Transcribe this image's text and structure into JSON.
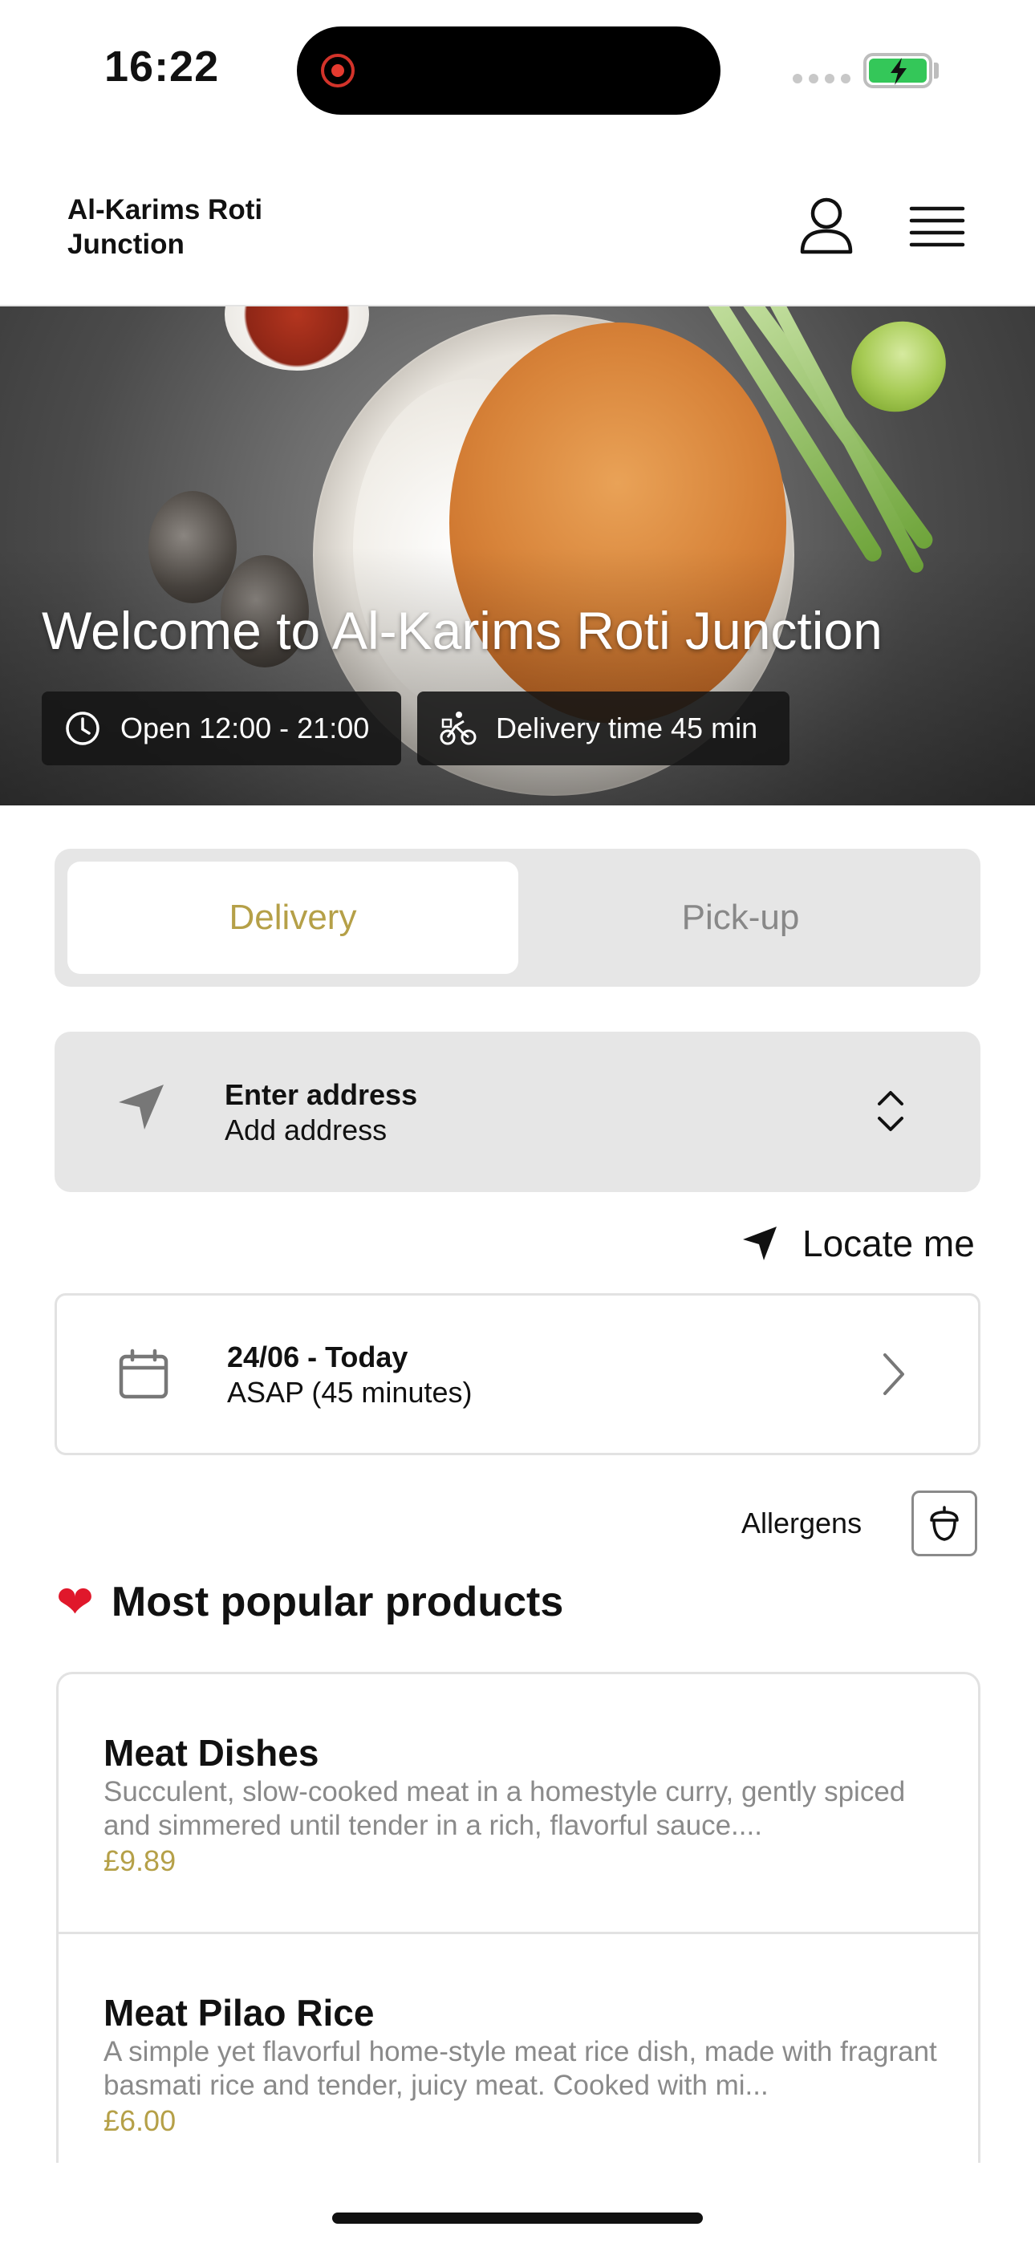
{
  "status_bar": {
    "time": "16:22"
  },
  "header": {
    "brand": "Al-Karims Roti Junction"
  },
  "hero": {
    "title": "Welcome to Al-Karims Roti Junction",
    "open_badge": "Open 12:00 - 21:00",
    "delivery_badge": "Delivery time 45 min"
  },
  "mode_toggle": {
    "options": [
      "Delivery",
      "Pick-up"
    ],
    "selected": "Delivery"
  },
  "address": {
    "title": "Enter address",
    "subtitle": "Add address",
    "locate_label": "Locate me"
  },
  "schedule": {
    "title": "24/06 - Today",
    "subtitle": "ASAP (45 minutes)"
  },
  "allergens": {
    "label": "Allergens"
  },
  "popular": {
    "title": "Most popular products",
    "products": [
      {
        "name": "Meat Dishes",
        "description": "Succulent, slow-cooked meat in a homestyle curry, gently spiced and simmered until tender in a rich, flavorful sauce....",
        "price": "£9.89"
      },
      {
        "name": "Meat Pilao Rice",
        "description": "A simple yet flavorful home-style meat rice dish, made with fragrant basmati rice and tender, juicy meat. Cooked with mi...",
        "price": "£6.00"
      }
    ]
  },
  "colors": {
    "accent": "#b5a048",
    "panel": "#e6e6e6",
    "badge_bg": "#141414",
    "battery": "#34c759"
  },
  "icons": [
    "user-icon",
    "menu-icon",
    "clock-icon",
    "bicycle-icon",
    "navigation-arrow-icon",
    "updown-chevron-icon",
    "calendar-icon",
    "chevron-right-icon",
    "acorn-icon",
    "heart-emoji"
  ]
}
